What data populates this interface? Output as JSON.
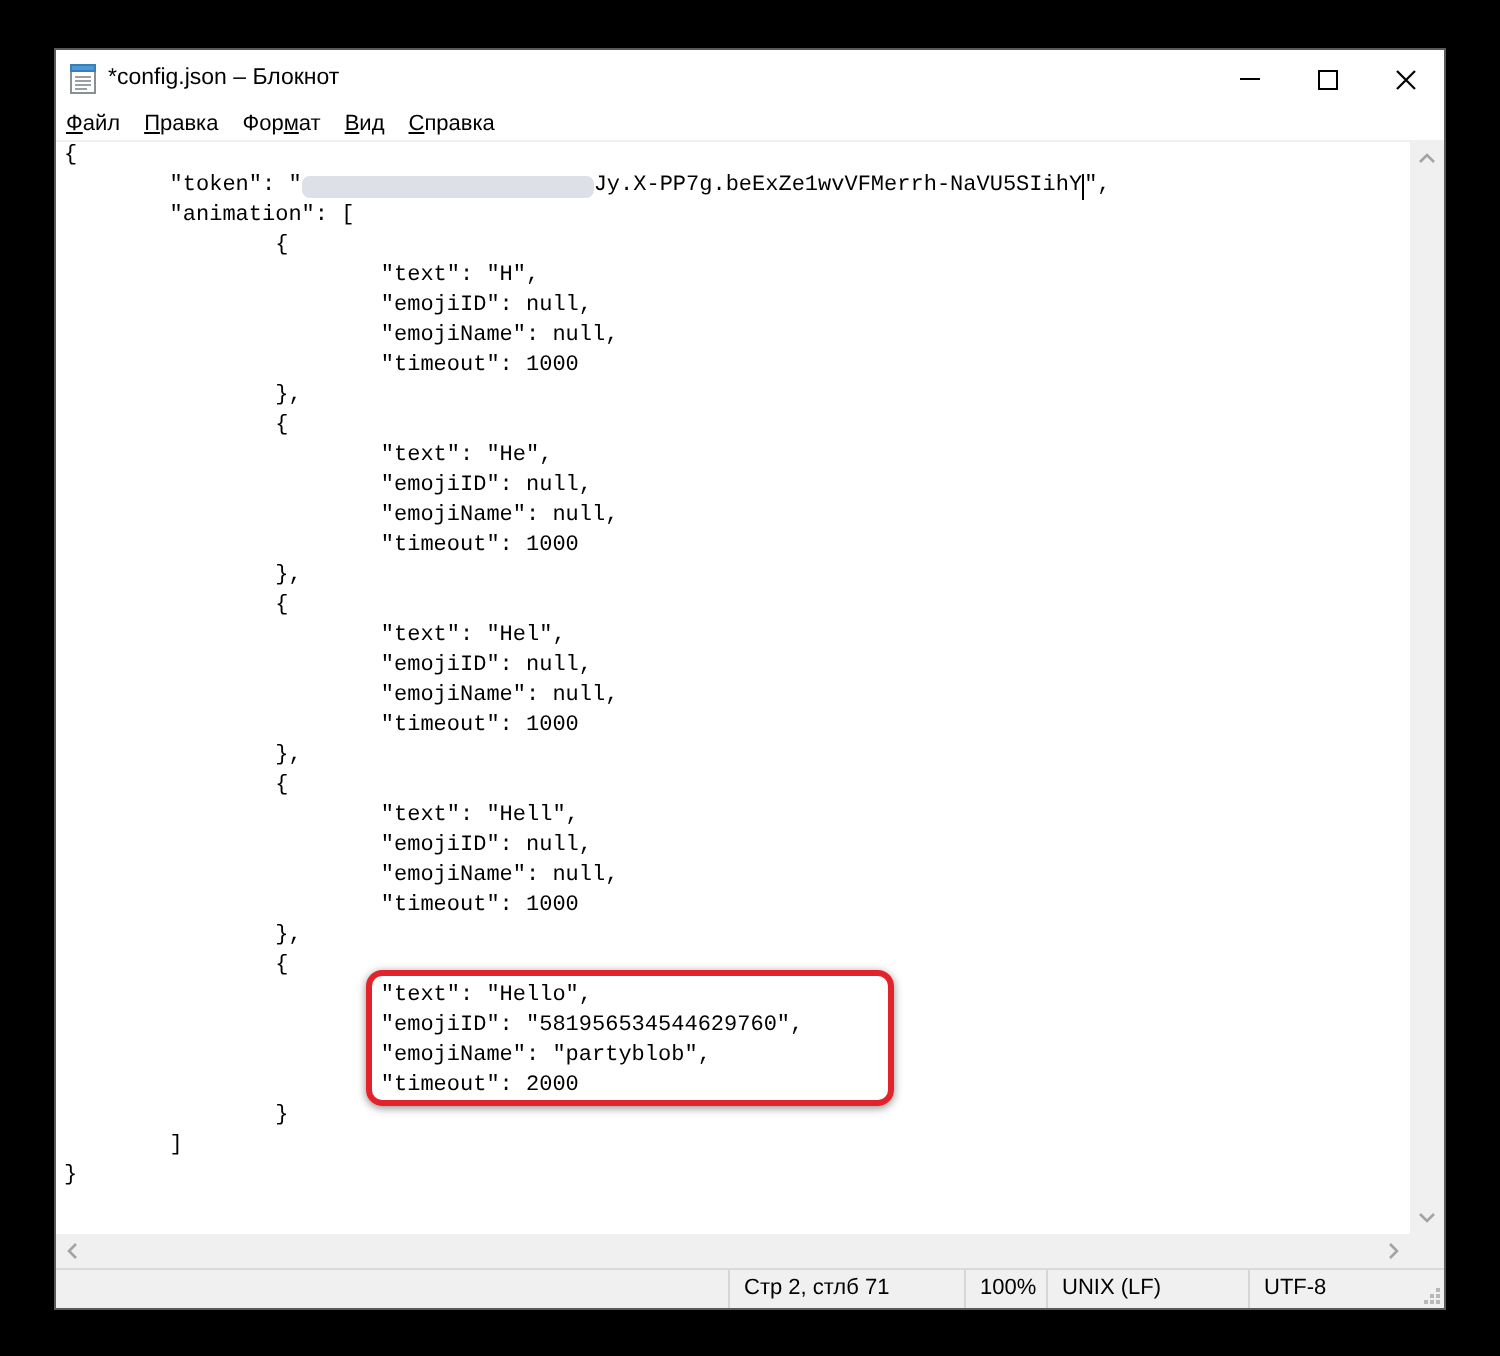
{
  "window": {
    "title": "*config.json – Блокнот"
  },
  "menu": [
    {
      "key": "Ф",
      "after": "айл"
    },
    {
      "key": "П",
      "after": "равка"
    },
    {
      "before": "Фор",
      "key": "м",
      "after": "ат"
    },
    {
      "key": "В",
      "after": "ид"
    },
    {
      "key": "С",
      "after": "правка"
    }
  ],
  "editor": {
    "lines": [
      {
        "kind": "plain",
        "text": "{",
        "highlighted": false,
        "children": [
          {
            "kind": "redacted",
            "text_before": "\"token\": \"",
            "text_after": "Jy.X-PP7g.beExZe1wvVFMerrh-NaVU5SIihY",
            "text_end": "\",",
            "highlighted": false,
            "caret": true
          },
          {
            "kind": "plain",
            "text": "\"animation\": [",
            "highlighted": false,
            "children": [
              {
                "kind": "plain",
                "text": "{",
                "highlighted": false,
                "children": [
                  {
                    "kind": "plain",
                    "text": "\"text\": \"H\",",
                    "highlighted": false
                  },
                  {
                    "kind": "plain",
                    "text": "\"emojiID\": null,",
                    "highlighted": false
                  },
                  {
                    "kind": "plain",
                    "text": "\"emojiName\": null,",
                    "highlighted": false
                  },
                  {
                    "kind": "plain",
                    "text": "\"timeout\": 1000",
                    "highlighted": false
                  }
                ]
              },
              {
                "kind": "plain",
                "text": "},",
                "highlighted": false
              },
              {
                "kind": "plain",
                "text": "{",
                "highlighted": false,
                "children": [
                  {
                    "kind": "plain",
                    "text": "\"text\": \"He\",",
                    "highlighted": false
                  },
                  {
                    "kind": "plain",
                    "text": "\"emojiID\": null,",
                    "highlighted": false
                  },
                  {
                    "kind": "plain",
                    "text": "\"emojiName\": null,",
                    "highlighted": false
                  },
                  {
                    "kind": "plain",
                    "text": "\"timeout\": 1000",
                    "highlighted": false
                  }
                ]
              },
              {
                "kind": "plain",
                "text": "},",
                "highlighted": false
              },
              {
                "kind": "plain",
                "text": "{",
                "highlighted": false,
                "children": [
                  {
                    "kind": "plain",
                    "text": "\"text\": \"Hel\",",
                    "highlighted": false
                  },
                  {
                    "kind": "plain",
                    "text": "\"emojiID\": null,",
                    "highlighted": false
                  },
                  {
                    "kind": "plain",
                    "text": "\"emojiName\": null,",
                    "highlighted": false
                  },
                  {
                    "kind": "plain",
                    "text": "\"timeout\": 1000",
                    "highlighted": false
                  }
                ]
              },
              {
                "kind": "plain",
                "text": "},",
                "highlighted": false
              },
              {
                "kind": "plain",
                "text": "{",
                "highlighted": false,
                "children": [
                  {
                    "kind": "plain",
                    "text": "\"text\": \"Hell\",",
                    "highlighted": false
                  },
                  {
                    "kind": "plain",
                    "text": "\"emojiID\": null,",
                    "highlighted": false
                  },
                  {
                    "kind": "plain",
                    "text": "\"emojiName\": null,",
                    "highlighted": false
                  },
                  {
                    "kind": "plain",
                    "text": "\"timeout\": 1000",
                    "highlighted": false
                  }
                ]
              },
              {
                "kind": "plain",
                "text": "},",
                "highlighted": false
              },
              {
                "kind": "plain",
                "text": "{",
                "highlighted": false,
                "children": [
                  {
                    "kind": "plain",
                    "text": "\"text\": \"Hello\",",
                    "highlighted": true
                  },
                  {
                    "kind": "plain",
                    "text": "\"emojiID\": \"581956534544629760\",",
                    "highlighted": true
                  },
                  {
                    "kind": "plain",
                    "text": "\"emojiName\": \"partyblob\",",
                    "highlighted": true
                  },
                  {
                    "kind": "plain",
                    "text": "\"timeout\": 2000",
                    "highlighted": true
                  }
                ]
              },
              {
                "kind": "plain",
                "text": "}",
                "highlighted": false
              }
            ]
          },
          {
            "kind": "plain",
            "text": "]",
            "highlighted": false
          }
        ]
      },
      {
        "kind": "plain",
        "text": "}",
        "highlighted": false
      }
    ]
  },
  "status_bar": {
    "fields": [
      "Стр 2, стлб 71",
      "100%",
      "UNIX (LF)",
      "UTF-8"
    ]
  }
}
